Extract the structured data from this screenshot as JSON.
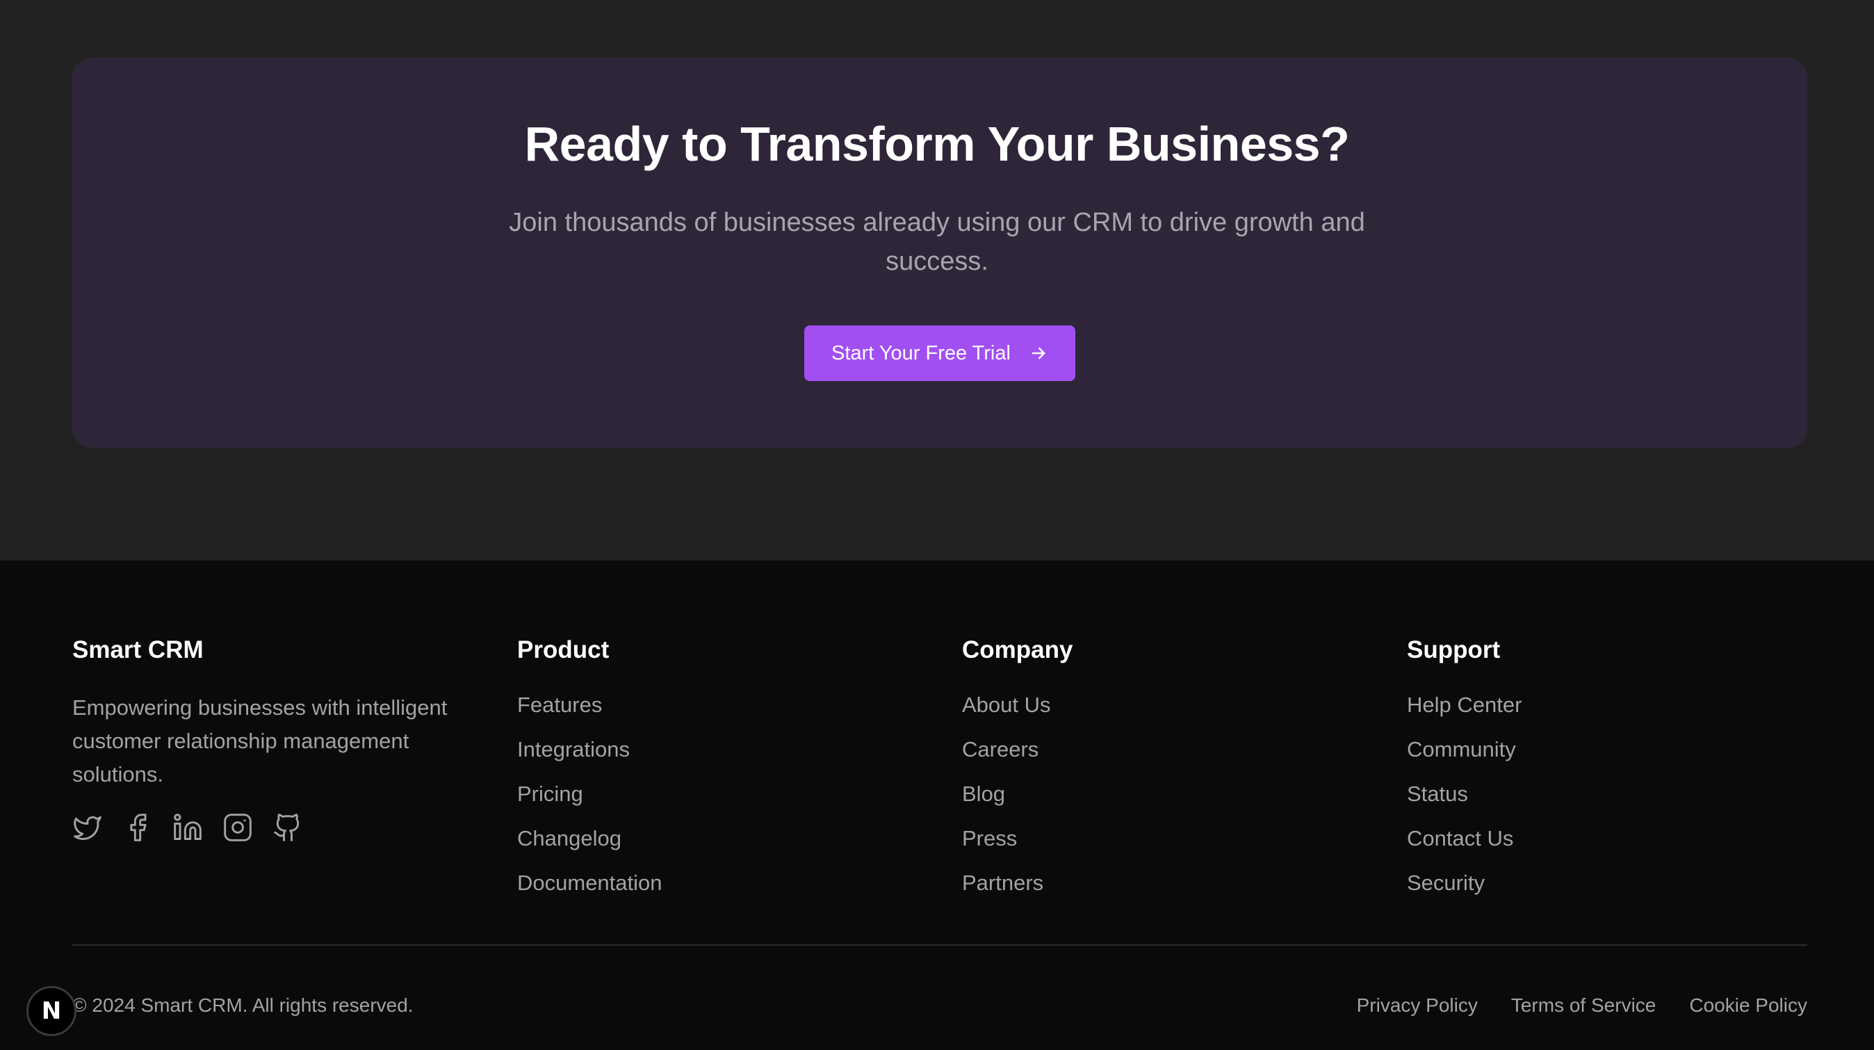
{
  "cta": {
    "title": "Ready to Transform Your Business?",
    "subtitle": "Join thousands of businesses already using our CRM to drive growth and success.",
    "button_label": "Start Your Free Trial",
    "button_icon": "arrow-right-icon",
    "accent_color": "#a24ff2"
  },
  "footer": {
    "brand": {
      "name": "Smart CRM",
      "description": "Empowering businesses with intelligent customer relationship management solutions.",
      "social": [
        "twitter-icon",
        "facebook-icon",
        "linkedin-icon",
        "instagram-icon",
        "github-icon"
      ]
    },
    "product": {
      "heading": "Product",
      "links": [
        "Features",
        "Integrations",
        "Pricing",
        "Changelog",
        "Documentation"
      ]
    },
    "company": {
      "heading": "Company",
      "links": [
        "About Us",
        "Careers",
        "Blog",
        "Press",
        "Partners"
      ]
    },
    "support": {
      "heading": "Support",
      "links": [
        "Help Center",
        "Community",
        "Status",
        "Contact Us",
        "Security"
      ]
    },
    "copyright": "© 2024 Smart CRM. All rights reserved.",
    "legal": [
      "Privacy Policy",
      "Terms of Service",
      "Cookie Policy"
    ]
  },
  "badge": {
    "letter": "N"
  }
}
